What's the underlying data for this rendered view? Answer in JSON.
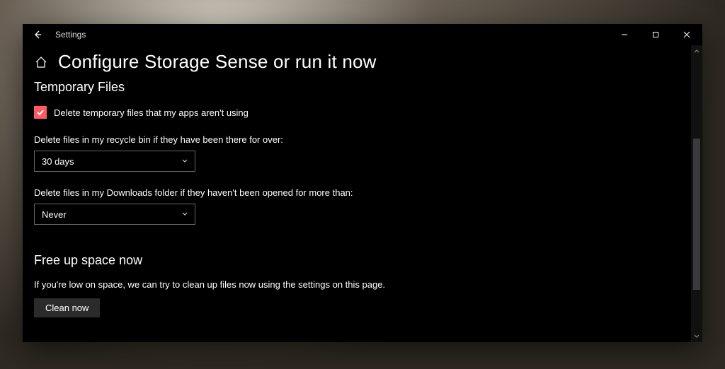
{
  "titlebar": {
    "app_name": "Settings"
  },
  "page": {
    "title": "Configure Storage Sense or run it now"
  },
  "section_temp": {
    "heading": "Temporary Files",
    "checkbox_label": "Delete temporary files that my apps aren't using",
    "checkbox_checked": true,
    "recycle_label": "Delete files in my recycle bin if they have been there for over:",
    "recycle_value": "30 days",
    "downloads_label": "Delete files in my Downloads folder if they haven't been opened for more than:",
    "downloads_value": "Never"
  },
  "section_free": {
    "heading": "Free up space now",
    "description": "If you're low on space, we can try to clean up files now using the settings on this page.",
    "button_label": "Clean now"
  }
}
